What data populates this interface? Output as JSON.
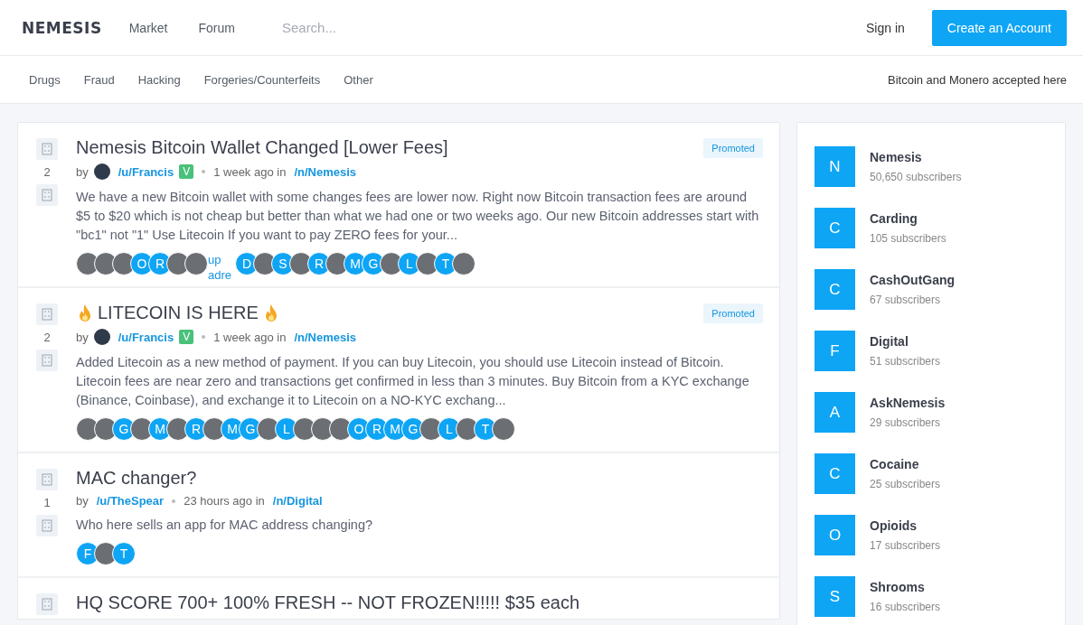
{
  "header": {
    "logo": "NEMESIS",
    "nav": [
      "Market",
      "Forum"
    ],
    "search": {
      "placeholder": "Search..."
    },
    "sign_in": "Sign in",
    "create_account": "Create an Account"
  },
  "categories": [
    "Drugs",
    "Fraud",
    "Hacking",
    "Forgeries/Counterfeits",
    "Other"
  ],
  "notice": "Bitcoin and Monero accepted here",
  "posts": [
    {
      "votes": "2",
      "title": "Nemesis Bitcoin Wallet Changed [Lower Fees]",
      "badge": "Promoted",
      "by": "by",
      "author": "/u/Francis",
      "author_avatar": true,
      "verified": "V",
      "time": "1 week ago in",
      "community": "/n/Nemesis",
      "excerpt": "We have a new Bitcoin wallet with some changes fees are lower now. Right now Bitcoin transaction fees are around $5 to $20 which is not cheap but better than what we had one or two weeks ago. Our new Bitcoin addresses start with \"bc1\" not \"1\" Use Litecoin If you want to pay ZERO fees for your...",
      "avatars": [
        {
          "kind": "image"
        },
        {
          "kind": "image"
        },
        {
          "kind": "image"
        },
        {
          "kind": "letter",
          "text": "O"
        },
        {
          "kind": "letter",
          "text": "R"
        },
        {
          "kind": "image"
        },
        {
          "kind": "image"
        },
        {
          "kind": "alt",
          "text": "up adre"
        },
        {
          "kind": "letter",
          "text": "D"
        },
        {
          "kind": "image"
        },
        {
          "kind": "letter",
          "text": "S"
        },
        {
          "kind": "image"
        },
        {
          "kind": "letter",
          "text": "R"
        },
        {
          "kind": "image"
        },
        {
          "kind": "letter",
          "text": "M"
        },
        {
          "kind": "letter",
          "text": "G"
        },
        {
          "kind": "image"
        },
        {
          "kind": "letter",
          "text": "L"
        },
        {
          "kind": "image"
        },
        {
          "kind": "letter",
          "text": "T"
        },
        {
          "kind": "image"
        }
      ]
    },
    {
      "votes": "2",
      "title": "LITECOIN IS HERE",
      "flame": true,
      "badge": "Promoted",
      "by": "by",
      "author": "/u/Francis",
      "author_avatar": true,
      "verified": "V",
      "time": "1 week ago in",
      "community": "/n/Nemesis",
      "excerpt": "Added Litecoin as a new method of payment. If you can buy Litecoin, you should use Litecoin instead of Bitcoin. Litecoin fees are near zero and transactions get confirmed in less than 3 minutes. Buy Bitcoin from a KYC exchange (Binance, Coinbase), and exchange it to Litecoin on a NO-KYC exchang...",
      "avatars": [
        {
          "kind": "image"
        },
        {
          "kind": "image"
        },
        {
          "kind": "letter",
          "text": "G"
        },
        {
          "kind": "image"
        },
        {
          "kind": "letter",
          "text": "M"
        },
        {
          "kind": "image"
        },
        {
          "kind": "letter",
          "text": "R"
        },
        {
          "kind": "image"
        },
        {
          "kind": "letter",
          "text": "M"
        },
        {
          "kind": "letter",
          "text": "G"
        },
        {
          "kind": "image"
        },
        {
          "kind": "letter",
          "text": "L"
        },
        {
          "kind": "image"
        },
        {
          "kind": "image"
        },
        {
          "kind": "image"
        },
        {
          "kind": "letter",
          "text": "O"
        },
        {
          "kind": "letter",
          "text": "R"
        },
        {
          "kind": "letter",
          "text": "M"
        },
        {
          "kind": "letter",
          "text": "G"
        },
        {
          "kind": "image"
        },
        {
          "kind": "letter",
          "text": "L"
        },
        {
          "kind": "image"
        },
        {
          "kind": "letter",
          "text": "T"
        },
        {
          "kind": "image"
        }
      ]
    },
    {
      "votes": "1",
      "title": "MAC changer?",
      "by": "by",
      "author": "/u/TheSpear",
      "time": "23 hours ago in",
      "community": "/n/Digital",
      "excerpt": "Who here sells an app for MAC address changing?",
      "avatars": [
        {
          "kind": "letter",
          "text": "F"
        },
        {
          "kind": "image"
        },
        {
          "kind": "letter",
          "text": "T"
        }
      ]
    },
    {
      "title": "HQ SCORE 700+ 100% FRESH -- NOT FROZEN!!!!! $35 each"
    }
  ],
  "communities": [
    {
      "letter": "N",
      "name": "Nemesis",
      "subscribers": "50,650 subscribers"
    },
    {
      "letter": "C",
      "name": "Carding",
      "subscribers": "105 subscribers"
    },
    {
      "letter": "C",
      "name": "CashOutGang",
      "subscribers": "67 subscribers"
    },
    {
      "letter": "F",
      "name": "Digital",
      "subscribers": "51 subscribers"
    },
    {
      "letter": "A",
      "name": "AskNemesis",
      "subscribers": "29 subscribers"
    },
    {
      "letter": "C",
      "name": "Cocaine",
      "subscribers": "25 subscribers"
    },
    {
      "letter": "O",
      "name": "Opioids",
      "subscribers": "17 subscribers"
    },
    {
      "letter": "S",
      "name": "Shrooms",
      "subscribers": "16 subscribers"
    }
  ]
}
